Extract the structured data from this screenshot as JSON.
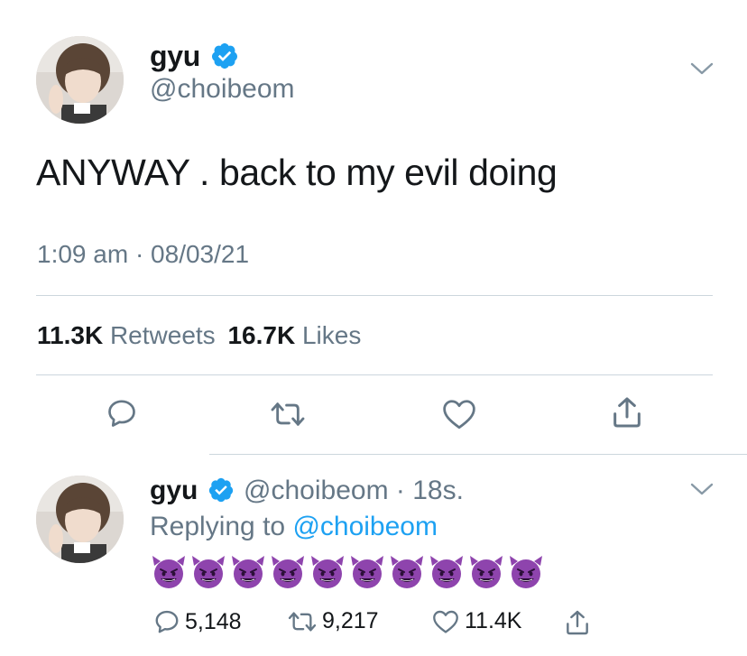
{
  "tweet": {
    "author_name": "gyu",
    "author_handle": "@choibeom",
    "verified_icon": "verified-badge-icon",
    "text": "ANYWAY . back to my evil doing",
    "timestamp": "1:09 am · 08/03/21",
    "retweets_count": "11.3K",
    "retweets_label": "Retweets",
    "likes_count": "16.7K",
    "likes_label": "Likes",
    "actions": [
      "reply-icon",
      "retweet-icon",
      "like-icon",
      "share-icon"
    ]
  },
  "reply": {
    "author_name": "gyu",
    "author_handle": "@choibeom",
    "age": "· 18s.",
    "replying_prefix": "Replying to",
    "replying_mention": "@choibeom",
    "emoji_name": "smiling-face-with-horns",
    "emoji_count": 10,
    "reply_count": "5,148",
    "retweet_count": "9,217",
    "like_count": "11.4K"
  },
  "colors": {
    "text": "#14171a",
    "secondary": "#657786",
    "accent": "#1da1f2",
    "divider": "#ccd6dd",
    "emoji_purple": "#8e44ad"
  }
}
